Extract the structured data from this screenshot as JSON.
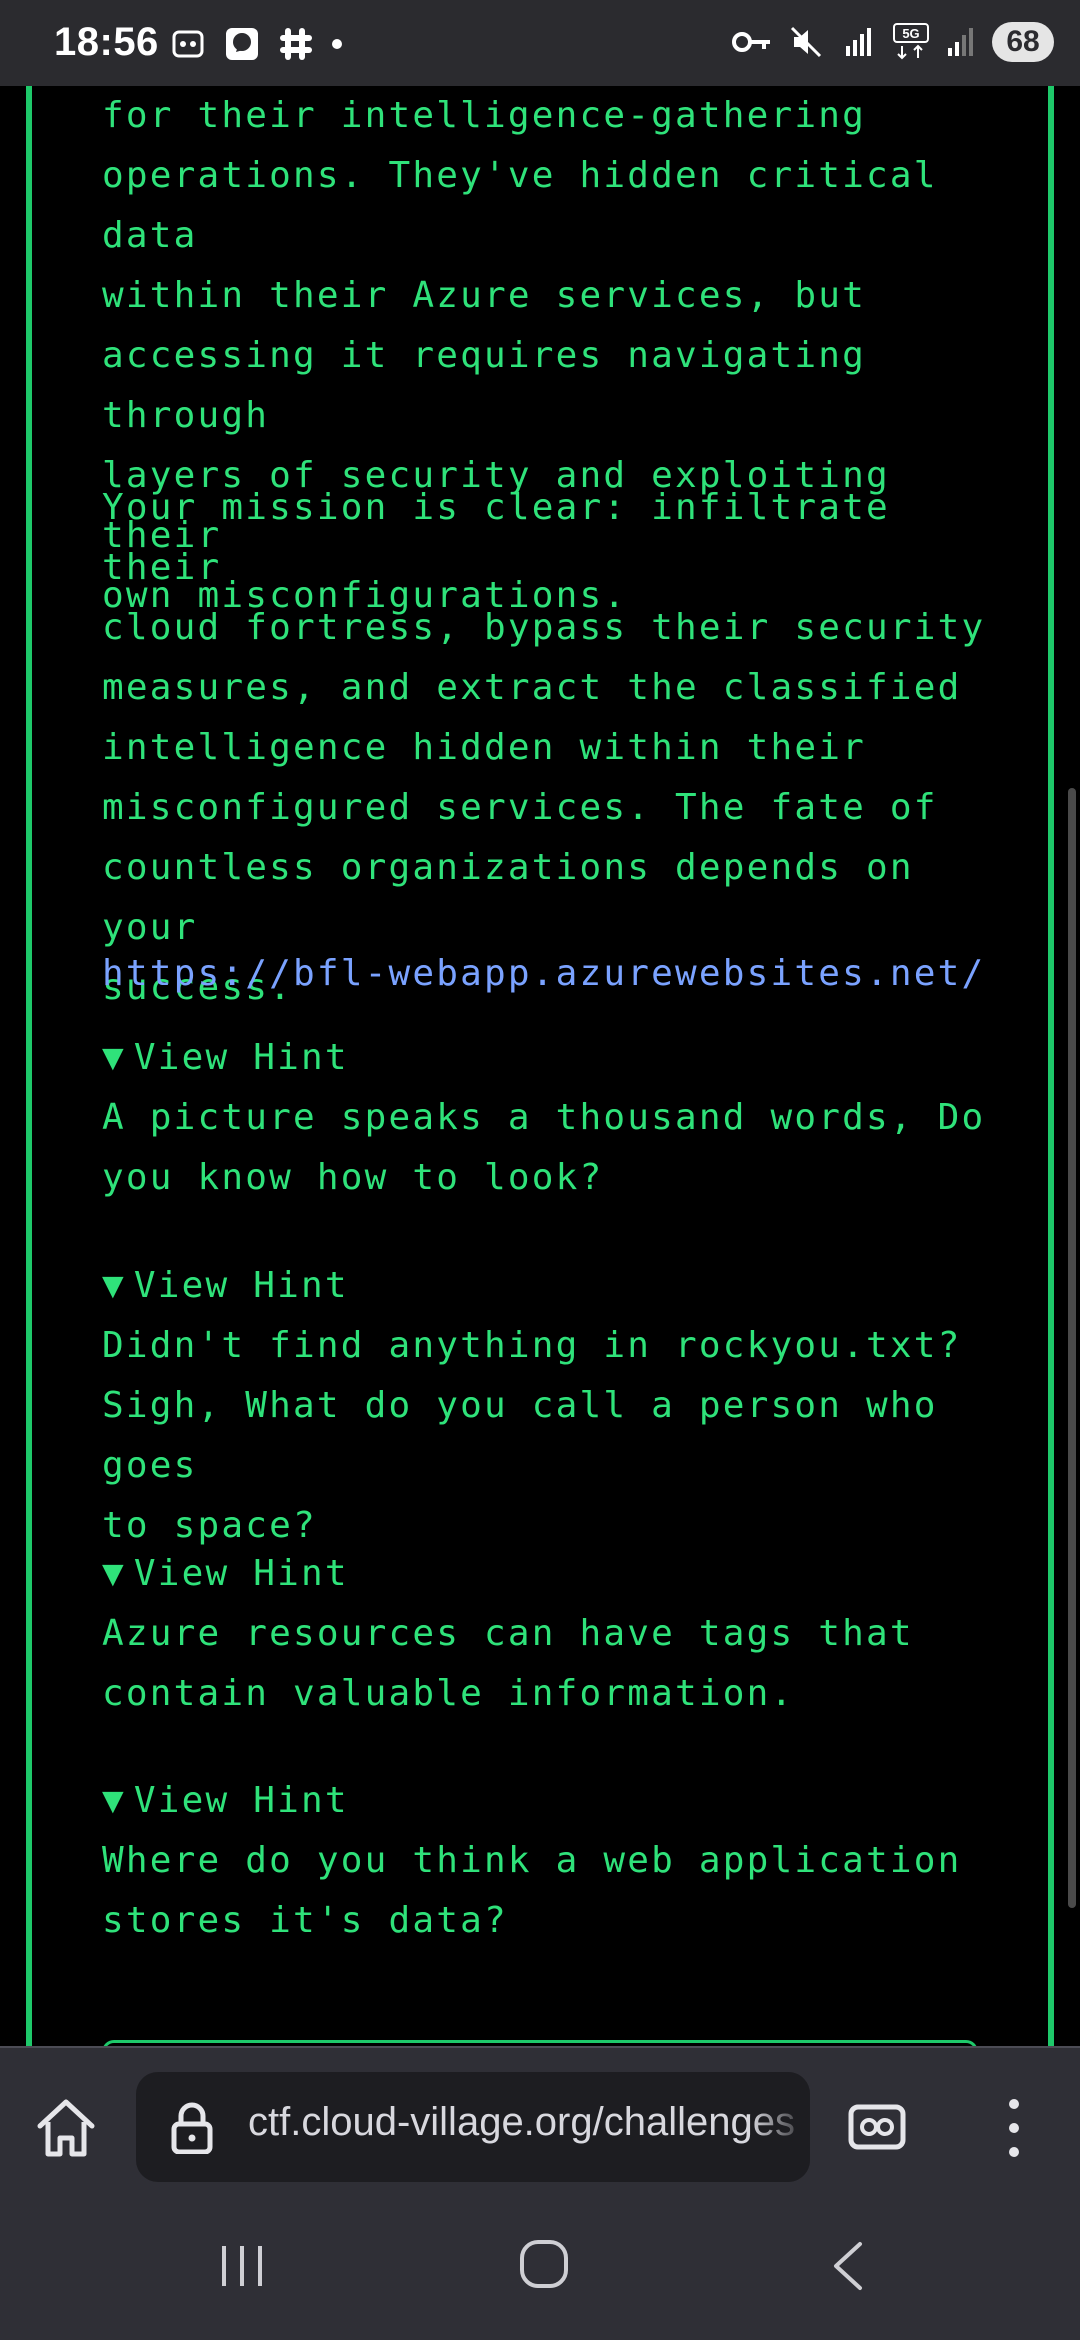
{
  "status_bar": {
    "time": "18:56",
    "battery": "68",
    "left_icons": [
      "screenshot-icon",
      "messenger-icon",
      "slack-icon",
      "dot-icon"
    ],
    "right_icons": [
      "vpn-key-icon",
      "mute-icon",
      "signal-r-icon",
      "5g-icon",
      "signal-icon"
    ]
  },
  "content": {
    "paragraph1_lines": [
      "for their intelligence-gathering",
      "operations. They've hidden critical data",
      "within their Azure services, but",
      "accessing it requires navigating through",
      "layers of security and exploiting their",
      "own misconfigurations."
    ],
    "paragraph2_lines": [
      "Your mission is clear: infiltrate their",
      "cloud fortress, bypass their security",
      "measures, and extract the classified",
      "intelligence hidden within their",
      "misconfigured services. The fate of",
      "countless organizations depends on your",
      "success."
    ],
    "link": "https://bfl-webapp.azurewebsites.net/",
    "hint_label": "View Hint",
    "hint_marker": "▼",
    "hints": [
      [
        "A picture speaks a thousand words, Do",
        "you know how to look?"
      ],
      [
        "Didn't find anything in rockyou.txt?",
        "Sigh, What do you call a person who goes",
        "to space?"
      ],
      [
        "Azure resources can have tags that",
        "contain valuable information."
      ],
      [
        "Where do you think a web application",
        "stores it's data?"
      ]
    ]
  },
  "browser": {
    "url": "ctf.cloud-village.org/challenges"
  },
  "colors": {
    "accent_green": "#2fe27a",
    "border_green": "#1ec96a",
    "link_blue": "#7aa2ff",
    "chrome_bg": "#2f2f36"
  }
}
